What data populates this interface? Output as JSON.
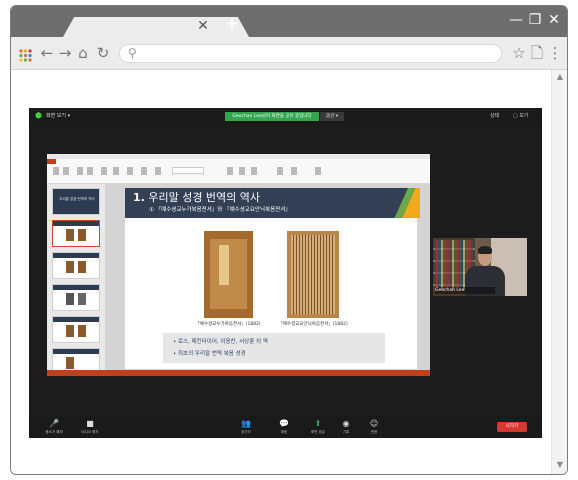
{
  "browser": {
    "new_tab_symbol": "+",
    "tab_close_symbol": "✕",
    "window_controls": {
      "minimize": "—",
      "restore": "❐",
      "close": "✕"
    },
    "nav": {
      "back": "←",
      "forward": "→",
      "home": "⌂",
      "reload": "↻"
    },
    "search_icon": "⚲",
    "star": "☆",
    "doc": "🗋",
    "menu": "⋮",
    "apps_icon_color": "#e06c2b"
  },
  "zoom": {
    "view_label": "화면 보기 ▾",
    "banner_text": "Geochan Lee님이 화면을 공유 중입니다",
    "stop_label": "옵션 ▾",
    "top_right_1": "상태",
    "top_right_2": "▢ 보기",
    "participant_name": "Geochan Lee",
    "end_label": "나가기",
    "toolbar": [
      {
        "icon": "🎤",
        "label": "음소거 해제"
      },
      {
        "icon": "■",
        "label": "비디오 중지"
      },
      {
        "icon": "👥",
        "label": "참가자"
      },
      {
        "icon": "💬",
        "label": "채팅"
      },
      {
        "icon": "⬆",
        "label": "화면 공유"
      },
      {
        "icon": "◉",
        "label": "기록"
      },
      {
        "icon": "☺",
        "label": "반응"
      }
    ]
  },
  "slide": {
    "title_num": "1.",
    "title_text": "우리말 성경 번역의 역사",
    "subtitle": "① 『예수셩교누가복음젼셔』와 『예수셩교요안닉복음젼셔』",
    "caption_left": "「예수셩교누가복음젼셔」(1882)",
    "caption_right": "「예수셩교요안닉복음젼셔」(1882)",
    "bullets": [
      "• 로스, 매킨타이어, 이응찬, 서상륜 외 역",
      "• 최초의 우리말 번역 복음 성경"
    ],
    "thumb1_title": "우리말 성경 번역의 역사"
  },
  "colors": {
    "slide_header": "#323f55",
    "accent_orange": "#f0a91b",
    "accent_green": "#6ba84a",
    "ppt_red": "#c43e1c",
    "zoom_green": "#2fa84f"
  }
}
